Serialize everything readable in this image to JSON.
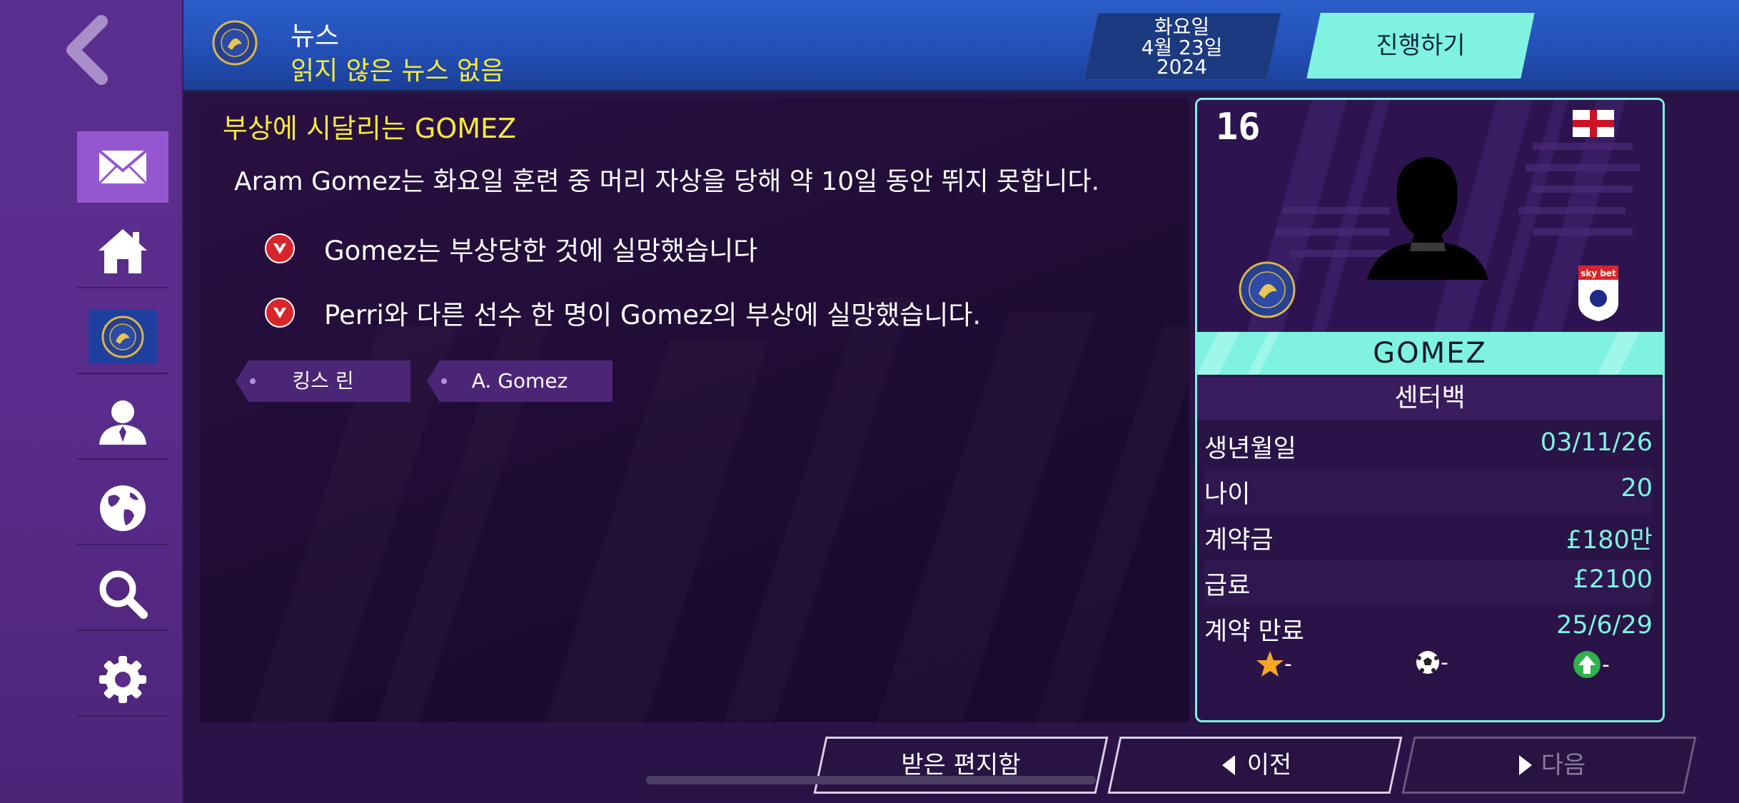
{
  "header": {
    "title": "뉴스",
    "subtitle": "읽지 않은 뉴스 없음",
    "date": {
      "weekday": "화요일",
      "date": "4월 23일",
      "year": "2024"
    },
    "continue_label": "진행하기"
  },
  "sidebar": {
    "items": [
      {
        "name": "inbox",
        "icon": "envelope-icon",
        "active": true
      },
      {
        "name": "home",
        "icon": "home-icon"
      },
      {
        "name": "club",
        "icon": "club-crest-icon"
      },
      {
        "name": "manager",
        "icon": "manager-icon"
      },
      {
        "name": "world",
        "icon": "globe-icon"
      },
      {
        "name": "search",
        "icon": "search-icon"
      },
      {
        "name": "settings",
        "icon": "gear-icon"
      }
    ]
  },
  "news": {
    "headline": "부상에 시달리는 GOMEZ",
    "body": "Aram Gomez는 화요일 훈련 중 머리 자상을 당해 약 10일 동안 뛰지 못합니다.",
    "reactions": [
      "Gomez는 부상당한 것에 실망했습니다",
      "Perri와 다른 선수 한 명이 Gomez의 부상에 실망했습니다."
    ],
    "tags": [
      "킹스 린",
      "A. Gomez"
    ]
  },
  "player": {
    "number": "16",
    "name": "GOMEZ",
    "position": "센터백",
    "stats": [
      {
        "label": "생년월일",
        "value": "03/11/26"
      },
      {
        "label": "나이",
        "value": "20"
      },
      {
        "label": "계약금",
        "value": "£180만"
      },
      {
        "label": "급료",
        "value": "£2100"
      },
      {
        "label": "계약 만료",
        "value": "25/6/29"
      }
    ],
    "icons": [
      {
        "icon": "star-icon",
        "value": "-"
      },
      {
        "icon": "football-icon",
        "value": "-"
      },
      {
        "icon": "up-arrow-icon",
        "value": "-"
      }
    ]
  },
  "bottom": {
    "inbox_label": "받은 편지함",
    "prev_label": "이전",
    "next_label": "다음"
  },
  "colors": {
    "accent": "#7ff3df",
    "headline": "#f5ea3a",
    "header_blue": "#2350b6",
    "sidebar_purple": "#5a2c8c",
    "active_nav": "#9557d0",
    "reaction_red": "#d7262b"
  }
}
